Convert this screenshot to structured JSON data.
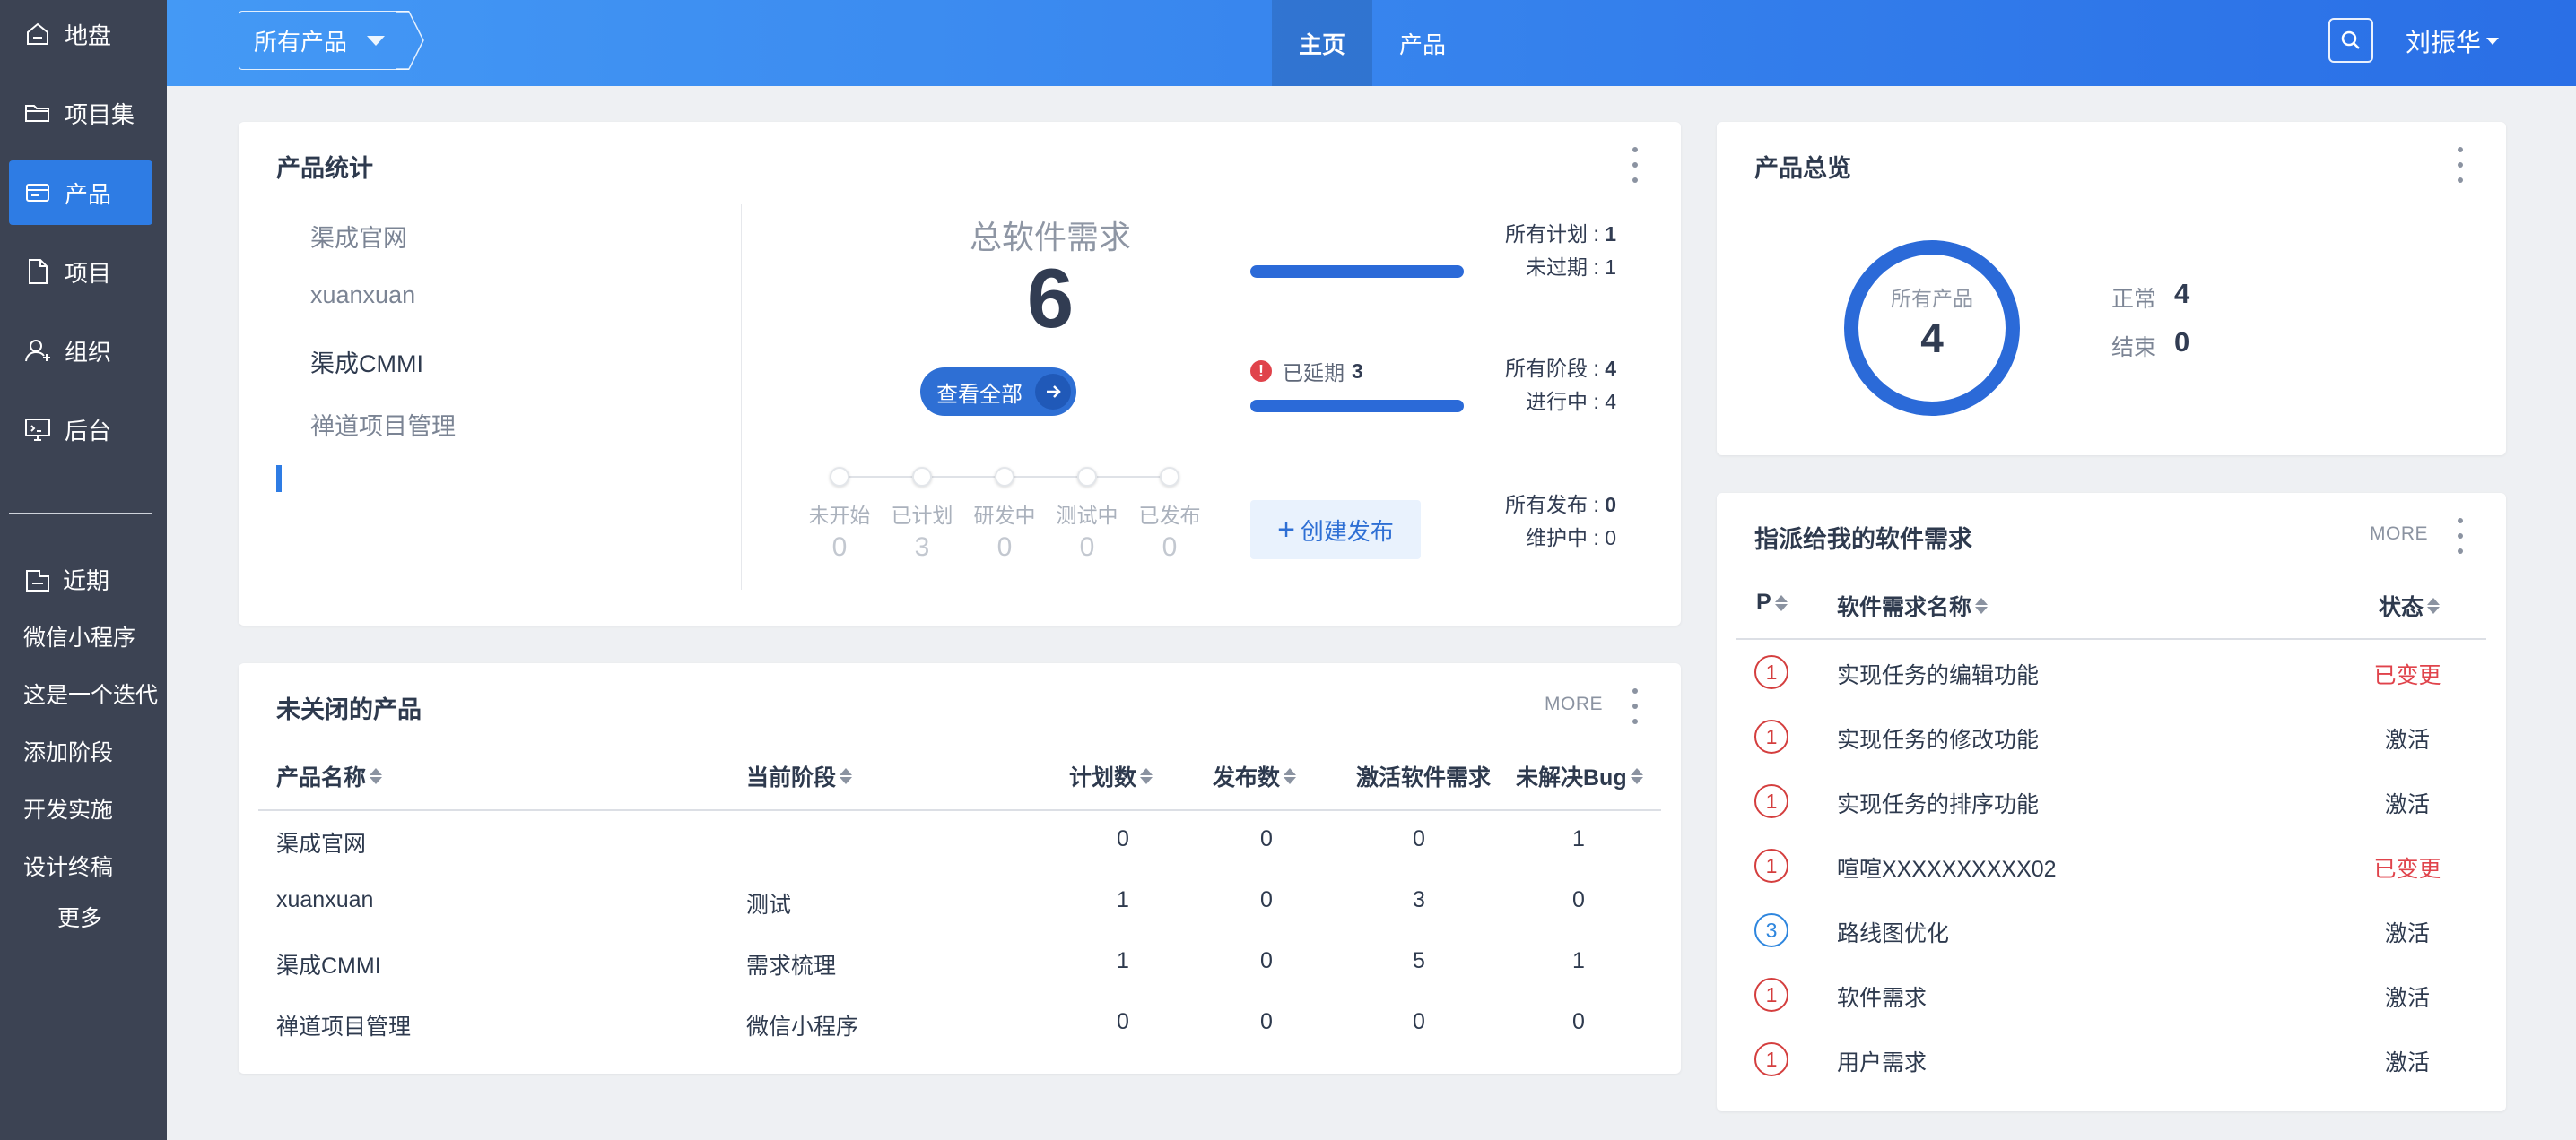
{
  "sidebar": {
    "items": [
      {
        "label": "地盘",
        "icon": "home-icon"
      },
      {
        "label": "项目集",
        "icon": "folder-icon"
      },
      {
        "label": "产品",
        "icon": "product-icon",
        "active": true
      },
      {
        "label": "项目",
        "icon": "file-icon"
      },
      {
        "label": "组织",
        "icon": "user-icon"
      },
      {
        "label": "后台",
        "icon": "monitor-icon"
      }
    ],
    "recent": {
      "title": "近期",
      "items": [
        "微信小程序",
        "这是一个迭代",
        "添加阶段",
        "开发实施",
        "设计终稿"
      ],
      "more": "更多"
    }
  },
  "header": {
    "product_select": "所有产品",
    "nav": [
      {
        "label": "主页",
        "active": true
      },
      {
        "label": "产品",
        "active": false
      }
    ],
    "user": "刘振华"
  },
  "product_stats": {
    "title": "产品统计",
    "products": [
      "渠成官网",
      "xuanxuan",
      "渠成CMMI",
      "禅道项目管理"
    ],
    "active_product": "渠成CMMI",
    "total_label": "总软件需求",
    "total": "6",
    "view_all": "查看全部",
    "stages": [
      {
        "label": "未开始",
        "value": "0"
      },
      {
        "label": "已计划",
        "value": "3"
      },
      {
        "label": "研发中",
        "value": "0"
      },
      {
        "label": "测试中",
        "value": "0"
      },
      {
        "label": "已发布",
        "value": "0"
      }
    ],
    "plans": {
      "all_label": "所有计划 : ",
      "all": "1",
      "unexpired_label": "未过期 : ",
      "unexpired": "1",
      "progress": 1.0
    },
    "delayed": {
      "label": "已延期",
      "value": "3"
    },
    "phases": {
      "all_label": "所有阶段 : ",
      "all": "4",
      "ongoing_label": "进行中 : ",
      "ongoing": "4",
      "progress": 1.0
    },
    "releases": {
      "all_label": "所有发布 : ",
      "all": "0",
      "maintaining_label": "维护中 : ",
      "maintaining": "0"
    },
    "create_release": "创建发布"
  },
  "unclosed_products": {
    "title": "未关闭的产品",
    "more": "MORE",
    "columns": [
      "产品名称",
      "当前阶段",
      "计划数",
      "发布数",
      "激活软件需求",
      "未解决Bug"
    ],
    "rows": [
      {
        "name": "渠成官网",
        "stage": "",
        "plans": "0",
        "releases": "0",
        "active_stories": "0",
        "bugs": "1"
      },
      {
        "name": "xuanxuan",
        "stage": "测试",
        "plans": "1",
        "releases": "0",
        "active_stories": "3",
        "bugs": "0"
      },
      {
        "name": "渠成CMMI",
        "stage": "需求梳理",
        "plans": "1",
        "releases": "0",
        "active_stories": "5",
        "bugs": "1"
      },
      {
        "name": "禅道项目管理",
        "stage": "微信小程序",
        "plans": "0",
        "releases": "0",
        "active_stories": "0",
        "bugs": "0"
      }
    ]
  },
  "product_overview": {
    "title": "产品总览",
    "center_label": "所有产品",
    "center_value": "4",
    "legend": [
      {
        "label": "正常",
        "value": "4"
      },
      {
        "label": "结束",
        "value": "0"
      }
    ],
    "ring_color": "#2b6ad8"
  },
  "assigned_stories": {
    "title": "指派给我的软件需求",
    "more": "MORE",
    "columns": [
      "P",
      "软件需求名称",
      "状态"
    ],
    "rows": [
      {
        "pri": "1",
        "name": "实现任务的编辑功能",
        "status": "已变更",
        "changed": true
      },
      {
        "pri": "1",
        "name": "实现任务的修改功能",
        "status": "激活",
        "changed": false
      },
      {
        "pri": "1",
        "name": "实现任务的排序功能",
        "status": "激活",
        "changed": false
      },
      {
        "pri": "1",
        "name": "喧喧XXXXXXXXXX02",
        "status": "已变更",
        "changed": true
      },
      {
        "pri": "3",
        "name": "路线图优化",
        "status": "激活",
        "changed": false
      },
      {
        "pri": "1",
        "name": "软件需求",
        "status": "激活",
        "changed": false
      },
      {
        "pri": "1",
        "name": "用户需求",
        "status": "激活",
        "changed": false
      }
    ]
  }
}
